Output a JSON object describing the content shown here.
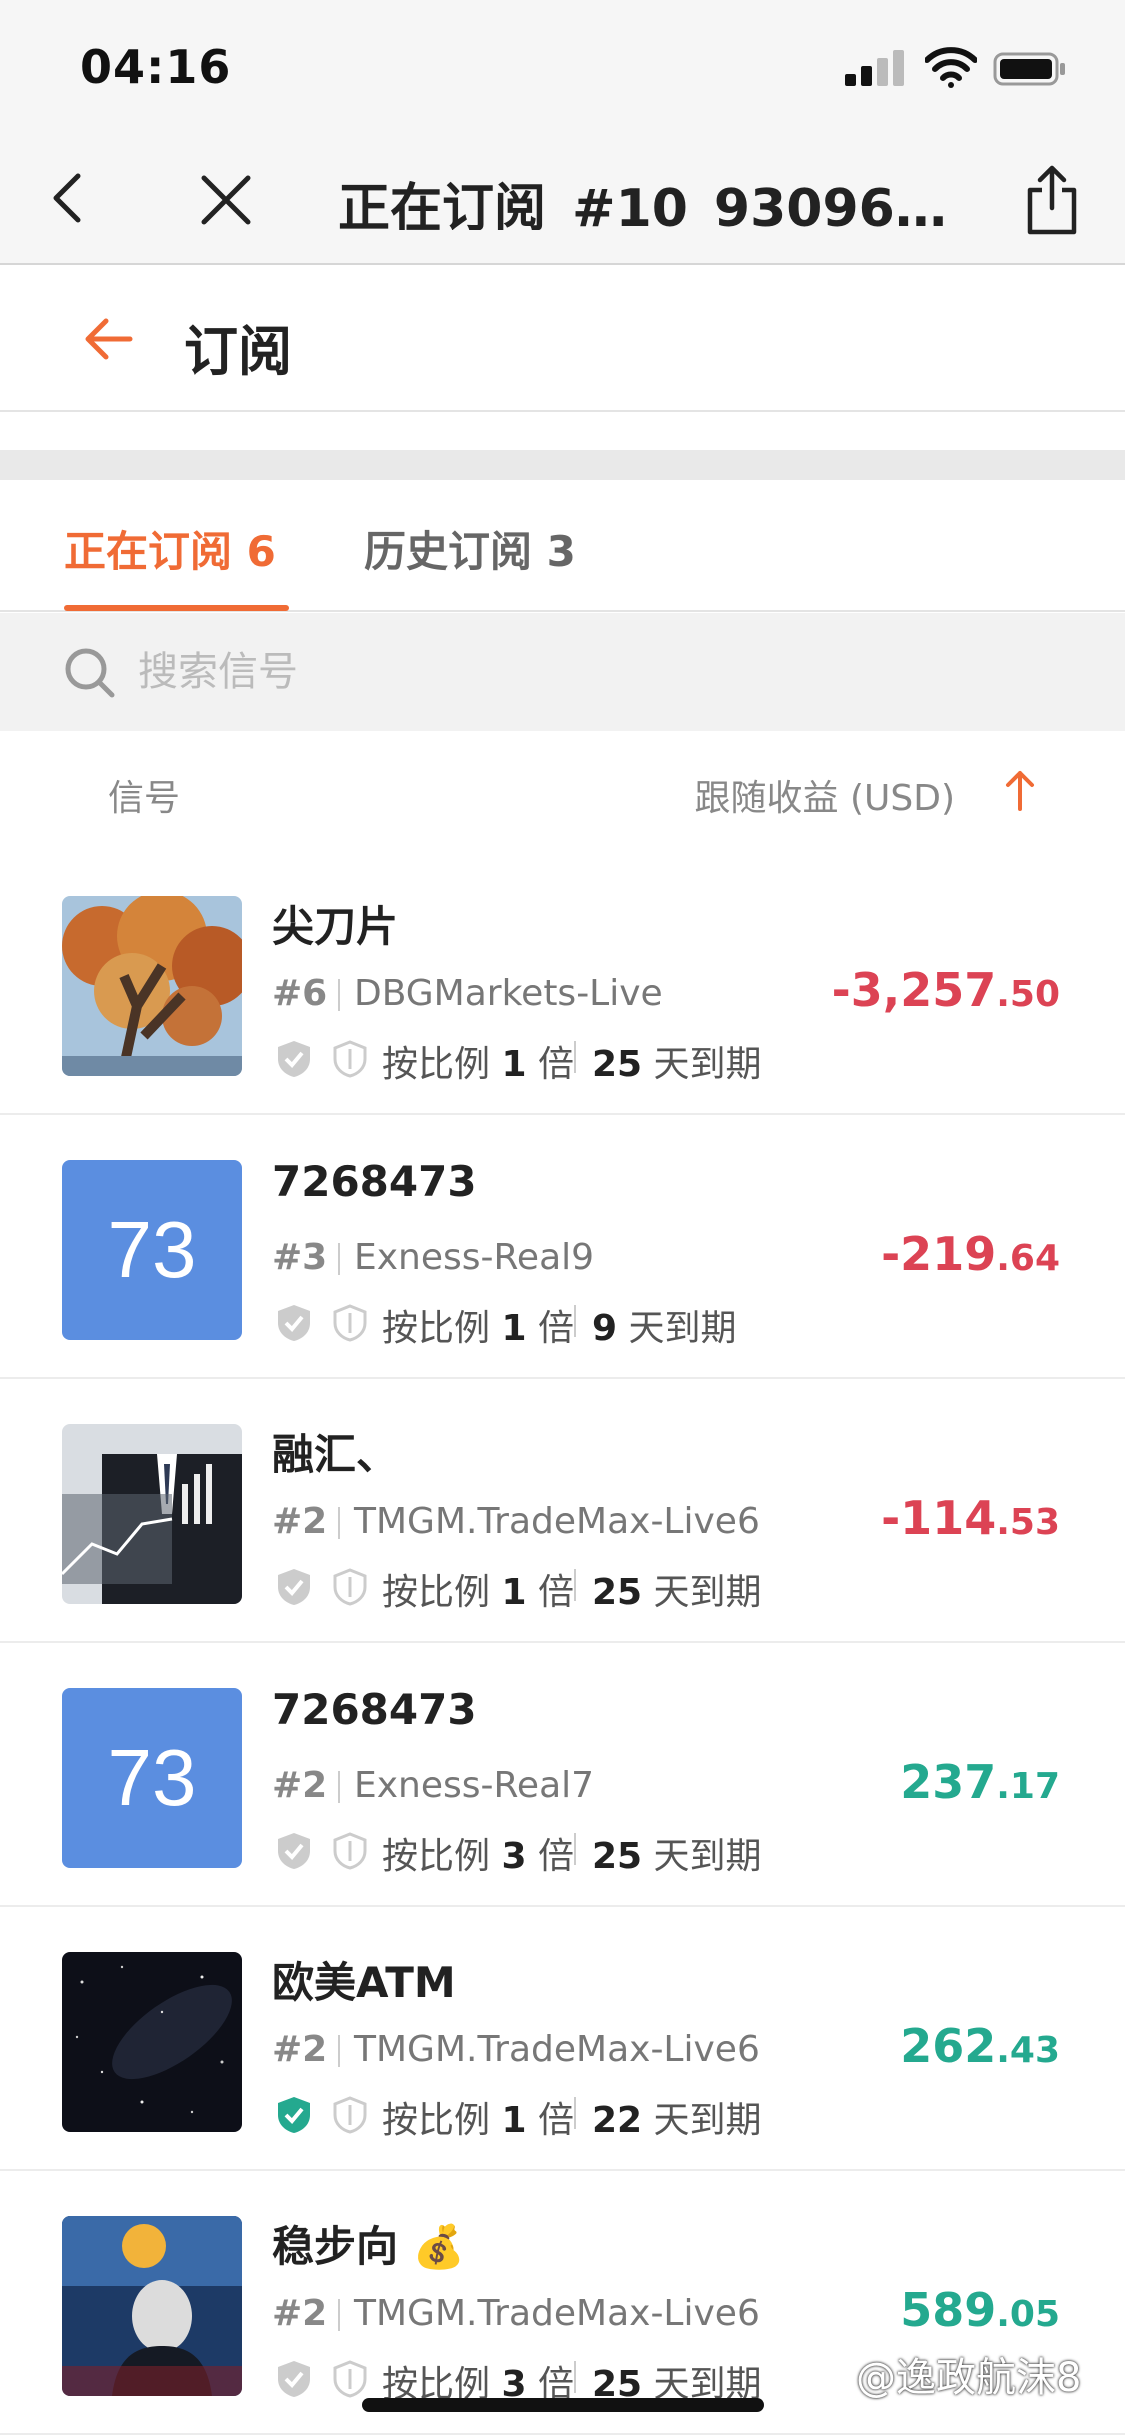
{
  "status_bar": {
    "time": "04:16"
  },
  "browser_nav": {
    "title": "正在订阅_#10_930965..."
  },
  "page": {
    "title": "订阅"
  },
  "tabs": [
    {
      "label": "正在订阅 6",
      "active": true
    },
    {
      "label": "历史订阅 3",
      "active": false
    }
  ],
  "search": {
    "placeholder": "搜索信号",
    "value": ""
  },
  "columns": {
    "signal": "信号",
    "return": "跟随收益 (USD)",
    "sort_icon": "arrow-up-icon"
  },
  "colors": {
    "accent": "#f06b35",
    "negative": "#dc4354",
    "positive": "#24a98f",
    "avatar_blue": "#5b8ee0"
  },
  "items": [
    {
      "name": "尖刀片",
      "rank": "#6",
      "server": "DBGMarkets-Live",
      "ratio_prefix": "按比例 ",
      "ratio_num": "1",
      "ratio_suffix": " 倍",
      "days": "25",
      "expire_suffix": " 天到期",
      "value_int": "-3,257",
      "value_dec": ".50",
      "sign": "neg",
      "thumb": "tree-photo",
      "verified": false
    },
    {
      "name": "7268473",
      "rank": "#3",
      "server": "Exness-Real9",
      "ratio_prefix": "按比例 ",
      "ratio_num": "1",
      "ratio_suffix": " 倍",
      "days": "9",
      "expire_suffix": " 天到期",
      "value_int": "-219",
      "value_dec": ".64",
      "sign": "neg",
      "thumb": "blue-73",
      "thumb_text": "73",
      "verified": false
    },
    {
      "name": "融汇、",
      "rank": "#2",
      "server": "TMGM.TradeMax-Live6",
      "ratio_prefix": "按比例 ",
      "ratio_num": "1",
      "ratio_suffix": " 倍",
      "days": "25",
      "expire_suffix": " 天到期",
      "value_int": "-114",
      "value_dec": ".53",
      "sign": "neg",
      "thumb": "businessman-chart-photo",
      "verified": false
    },
    {
      "name": "7268473",
      "rank": "#2",
      "server": "Exness-Real7",
      "ratio_prefix": "按比例 ",
      "ratio_num": "3",
      "ratio_suffix": " 倍",
      "days": "25",
      "expire_suffix": " 天到期",
      "value_int": "237",
      "value_dec": ".17",
      "sign": "pos",
      "thumb": "blue-73",
      "thumb_text": "73",
      "verified": false
    },
    {
      "name": "欧美ATM",
      "rank": "#2",
      "server": "TMGM.TradeMax-Live6",
      "ratio_prefix": "按比例 ",
      "ratio_num": "1",
      "ratio_suffix": " 倍",
      "days": "22",
      "expire_suffix": " 天到期",
      "value_int": "262",
      "value_dec": ".43",
      "sign": "pos",
      "thumb": "night-sky-photo",
      "verified": true
    },
    {
      "name": "稳步向 💰",
      "rank": "#2",
      "server": "TMGM.TradeMax-Live6",
      "ratio_prefix": "按比例 ",
      "ratio_num": "3",
      "ratio_suffix": " 倍",
      "days": "25",
      "expire_suffix": " 天到期",
      "value_int": "589",
      "value_dec": ".05",
      "sign": "pos",
      "thumb": "masked-figure-photo",
      "verified": false
    }
  ],
  "watermark": "@逸政航沫8"
}
